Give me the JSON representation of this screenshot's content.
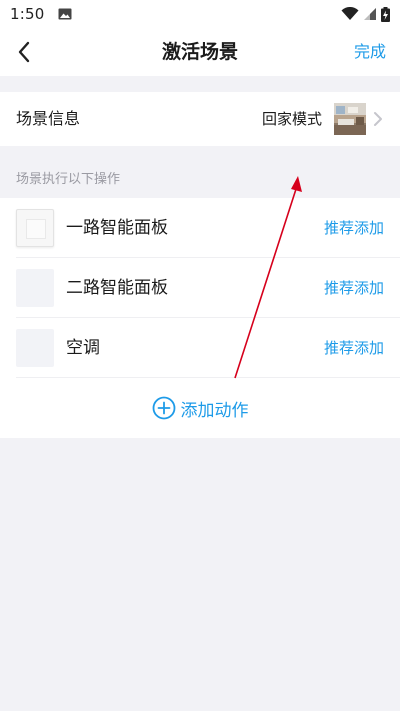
{
  "status_bar": {
    "time": "1:50",
    "icons": [
      "image-icon",
      "wifi-icon",
      "signal-icon",
      "battery-icon"
    ]
  },
  "nav": {
    "title": "激活场景",
    "done_label": "完成",
    "back_icon": "chevron-left-icon"
  },
  "scene_info": {
    "label": "场景信息",
    "value": "回家模式",
    "thumbnail": "room-photo",
    "chevron_icon": "chevron-right-icon"
  },
  "actions_section": {
    "header": "场景执行以下操作",
    "items": [
      {
        "name": "一路智能面板",
        "action_label": "推荐添加",
        "icon": "wall-switch-icon"
      },
      {
        "name": "二路智能面板",
        "action_label": "推荐添加",
        "icon": "device-placeholder-icon"
      },
      {
        "name": "空调",
        "action_label": "推荐添加",
        "icon": "device-placeholder-icon"
      }
    ],
    "add_label": "添加动作",
    "add_icon": "plus-circle-icon"
  },
  "colors": {
    "accent": "#1e9be8",
    "background": "#f2f2f6",
    "card": "#ffffff",
    "annotation": "#d6001c"
  }
}
